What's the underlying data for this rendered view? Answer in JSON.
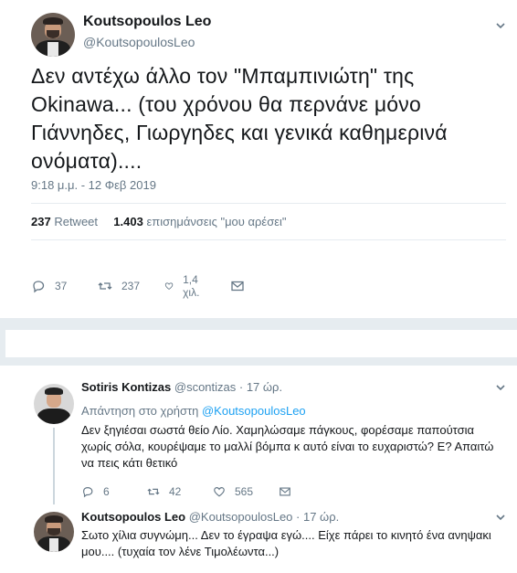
{
  "main_tweet": {
    "author_name": "Koutsopoulos Leo",
    "author_handle": "@KoutsopoulosLeo",
    "text": "Δεν αντέχω άλλο τον \"Μπαμπινιώτη\" της Okinawa... (του χρόνου θα περνάνε μόνο Γιάννηδες, Γιωργηδες και γενικά καθημερινά ονόματα)....",
    "timestamp": "9:18 μ.μ. - 12 Φεβ 2019",
    "retweets_count": "237",
    "retweets_label": "Retweet",
    "likes_count": "1.403",
    "likes_label": "επισημάνσεις \"μου αρέσει\"",
    "actions": {
      "reply_count": "37",
      "retweet_count": "237",
      "like_count": "1,4 χιλ."
    }
  },
  "replies": [
    {
      "author_name": "Sotiris Kontizas",
      "author_handle": "@scontizas",
      "time": "· 17 ώρ.",
      "replying_to_label": "Απάντηση στο χρήστη",
      "replying_to_handle": "@KoutsopoulosLeo",
      "text": "Δεν ξηγιέσαι σωστά θείο Λίο. Χαμηλώσαμε πάγκους, φορέσαμε παπούτσια χωρίς σόλα, κουρέψαμε το μαλλί βόμπα κ αυτό είναι το ευχαριστώ? Ε? Απαιτώ να πεις κάτι θετικό",
      "reply_count": "6",
      "retweet_count": "42",
      "like_count": "565"
    },
    {
      "author_name": "Koutsopoulos Leo",
      "author_handle": "@KoutsopoulosLeo",
      "time": "· 17 ώρ.",
      "text": "Σωτο χίλια συγνώμη... Δεν το έγραψα εγώ.... Είχε πάρει το κινητό ένα ανηψακι μου.... (τυχαία τον λένε Τιμολέωντα...)"
    }
  ],
  "icons": {
    "reply": "reply-icon",
    "retweet": "retweet-icon",
    "like": "heart-icon",
    "message": "envelope-icon",
    "caret": "chevron-down-icon"
  },
  "colors": {
    "text": "#14171a",
    "secondary": "#657786",
    "link": "#1da1f2",
    "divider": "#e6ecf0"
  }
}
